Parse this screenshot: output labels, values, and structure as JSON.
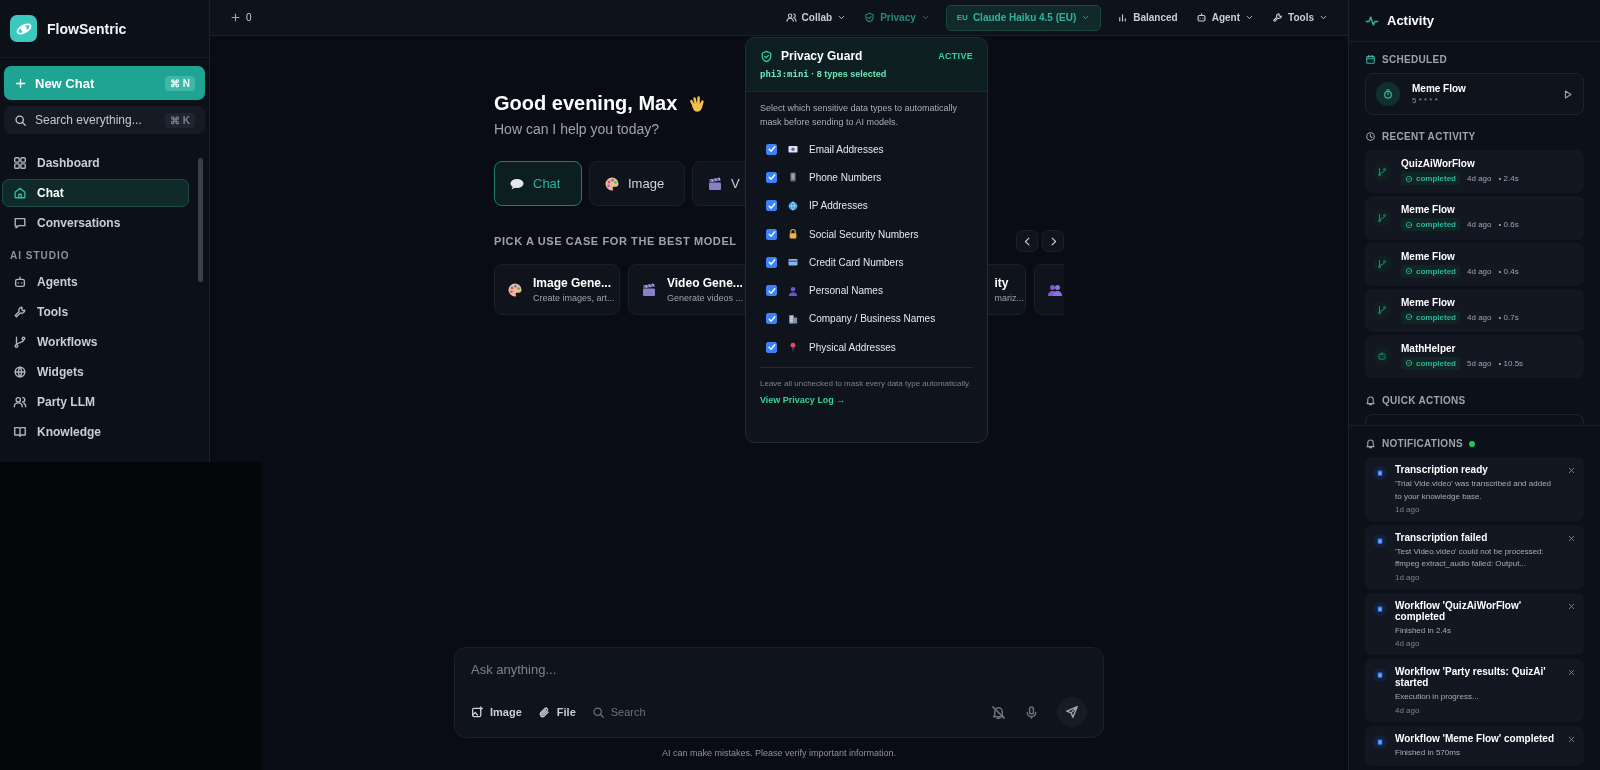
{
  "brand": {
    "name": "FlowSentric"
  },
  "sidebar": {
    "new_chat": {
      "label": "New Chat",
      "shortcut": "⌘ N"
    },
    "search": {
      "placeholder": "Search everything...",
      "shortcut": "⌘ K"
    },
    "items": [
      {
        "label": "Dashboard",
        "selected": false
      },
      {
        "label": "Chat",
        "selected": true
      },
      {
        "label": "Conversations",
        "selected": false
      }
    ],
    "sections": [
      {
        "title": "AI STUDIO",
        "items": [
          {
            "label": "Agents",
            "selected": false
          },
          {
            "label": "Tools",
            "selected": false
          },
          {
            "label": "Workflows",
            "selected": false
          },
          {
            "label": "Widgets",
            "selected": false
          },
          {
            "label": "Party LLM",
            "selected": false
          },
          {
            "label": "Knowledge",
            "selected": false
          }
        ]
      }
    ]
  },
  "top_bar": {
    "credits": "0",
    "menus": [
      {
        "label": "Collab",
        "kind": "menu"
      },
      {
        "label": "Privacy",
        "kind": "open"
      },
      {
        "label": "Claude Haiku 4.5 (EU)",
        "kind": "model",
        "badge": "EU"
      },
      {
        "label": "Balanced",
        "kind": "plain"
      },
      {
        "label": "Agent",
        "kind": "menu"
      },
      {
        "label": "Tools",
        "kind": "menu"
      }
    ]
  },
  "main": {
    "greeting": "Good evening, Max",
    "subtitle": "How can I help you today?",
    "modes": [
      {
        "label": "Chat",
        "selected": true
      },
      {
        "label": "Image",
        "selected": false
      },
      {
        "label": "V",
        "selected": false
      }
    ],
    "use_case_title": "PICK A USE CASE FOR THE BEST MODEL",
    "use_cases": [
      {
        "kind": "card",
        "title": "Image Gene...",
        "description": "Create images, art..."
      },
      {
        "kind": "card",
        "title": "Video Gene...",
        "description": "Generate videos ..."
      },
      {
        "kind": "covered",
        "title": "ity",
        "description": "mariz..."
      },
      {
        "kind": "edge"
      }
    ]
  },
  "composer": {
    "placeholder": "Ask anything...",
    "tools": [
      {
        "label": "Image",
        "disabled": false
      },
      {
        "label": "File",
        "disabled": false
      },
      {
        "label": "Search",
        "disabled": true
      }
    ],
    "disclaimer": "AI can make mistakes. Please verify important information."
  },
  "privacy_popup": {
    "title": "Privacy Guard",
    "status": "ACTIVE",
    "model": "phi3:mini",
    "summary": "· 8 types selected",
    "description": "Select which sensitive data types to automatically mask before sending to AI models.",
    "types": [
      {
        "label": "Email Addresses",
        "checked": true
      },
      {
        "label": "Phone Numbers",
        "checked": true
      },
      {
        "label": "IP Addresses",
        "checked": true
      },
      {
        "label": "Social Security Numbers",
        "checked": true
      },
      {
        "label": "Credit Card Numbers",
        "checked": true
      },
      {
        "label": "Personal Names",
        "checked": true
      },
      {
        "label": "Company / Business Names",
        "checked": true
      },
      {
        "label": "Physical Addresses",
        "checked": true
      }
    ],
    "footnote": "Leave all unchecked to mask every data type automatically.",
    "link": "View Privacy Log →"
  },
  "activity": {
    "title": "Activity",
    "scheduled": {
      "title": "SCHEDULED",
      "items": [
        {
          "name": "Meme Flow",
          "schedule": "5 * * * *"
        }
      ]
    },
    "recent": {
      "title": "RECENT ACTIVITY",
      "items": [
        {
          "name": "QuizAiWorFlow",
          "kind": "workflow",
          "status": "completed",
          "time": "4d ago",
          "duration": "• 2.4s"
        },
        {
          "name": "Meme Flow",
          "kind": "workflow",
          "status": "completed",
          "time": "4d ago",
          "duration": "• 0.6s"
        },
        {
          "name": "Meme Flow",
          "kind": "workflow",
          "status": "completed",
          "time": "4d ago",
          "duration": "• 0.4s"
        },
        {
          "name": "Meme Flow",
          "kind": "workflow",
          "status": "completed",
          "time": "4d ago",
          "duration": "• 0.7s"
        },
        {
          "name": "MathHelper",
          "kind": "agent",
          "status": "completed",
          "time": "5d ago",
          "duration": "• 10.5s"
        }
      ]
    },
    "quick_actions": {
      "title": "QUICK ACTIONS"
    },
    "notifications": {
      "title": "NOTIFICATIONS",
      "items": [
        {
          "title": "Transcription ready",
          "message": "'Trial Vide.video' was transcribed and added to your knowledge base.",
          "time": "1d ago"
        },
        {
          "title": "Transcription failed",
          "message": "'Test Video.video' could not be processed: ffmpeg extract_audio failed: Output...",
          "time": "1d ago"
        },
        {
          "title": "Workflow 'QuizAiWorFlow' completed",
          "message": "Finished in 2.4s",
          "time": "4d ago"
        },
        {
          "title": "Workflow 'Party results: QuizAi' started",
          "message": "Execution in progress...",
          "time": "4d ago"
        },
        {
          "title": "Workflow 'Meme Flow' completed",
          "message": "Finished in 570ms"
        }
      ]
    }
  }
}
